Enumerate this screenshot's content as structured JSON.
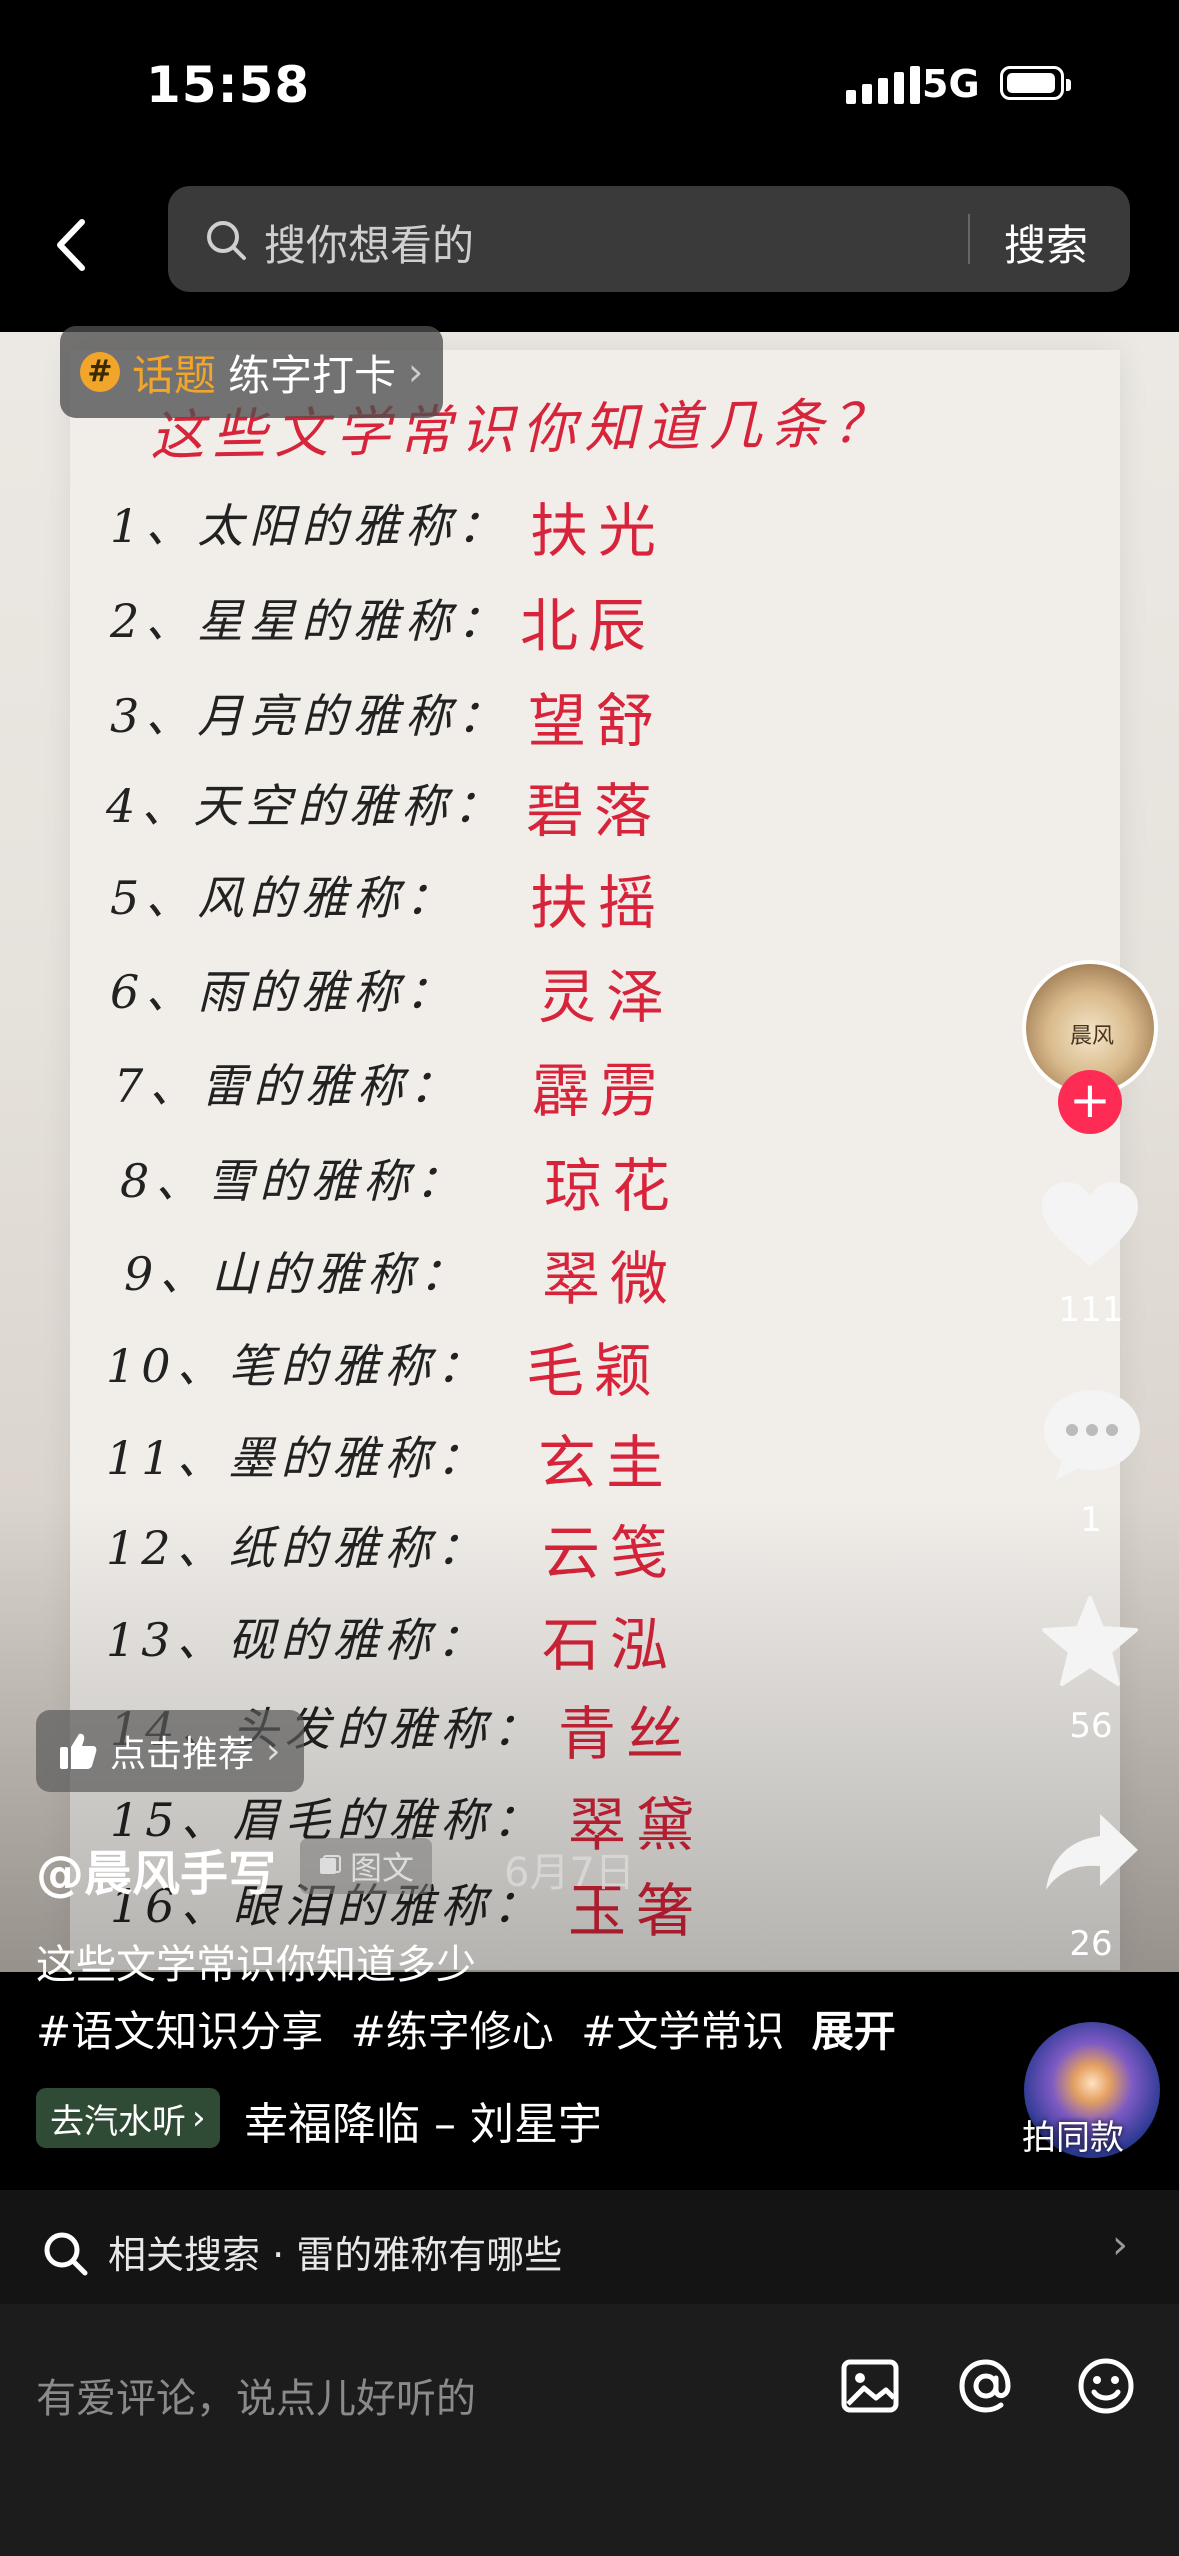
{
  "status_bar": {
    "time": "15:58",
    "network": "5G"
  },
  "search": {
    "placeholder": "搜你想看的",
    "button": "搜索"
  },
  "topic": {
    "kind": "话题",
    "name": "练字打卡",
    "icon_symbol": "#"
  },
  "note": {
    "title": "这些文学常识你知道几条？",
    "rows": [
      {
        "q": "1、太阳的雅称：",
        "a": "扶光"
      },
      {
        "q": "2、星星的雅称：",
        "a": "北辰"
      },
      {
        "q": "3、月亮的雅称：",
        "a": "望舒"
      },
      {
        "q": "4、天空的雅称：",
        "a": "碧落"
      },
      {
        "q": "5、风的雅称：",
        "a": "扶摇"
      },
      {
        "q": "6、雨的雅称：",
        "a": "灵泽"
      },
      {
        "q": "7、雷的雅称：",
        "a": "霹雳"
      },
      {
        "q": "8、雪的雅称：",
        "a": "琼花"
      },
      {
        "q": "9、山的雅称：",
        "a": "翠微"
      },
      {
        "q": "10、笔的雅称：",
        "a": "毛颖"
      },
      {
        "q": "11、墨的雅称：",
        "a": "玄圭"
      },
      {
        "q": "12、纸的雅称：",
        "a": "云笺"
      },
      {
        "q": "13、砚的雅称：",
        "a": "石泓"
      },
      {
        "q": "14、头发的雅称：",
        "a": "青丝"
      },
      {
        "q": "15、眉毛的雅称：",
        "a": "翠黛"
      },
      {
        "q": "16、眼泪的雅称：",
        "a": "玉箸"
      }
    ]
  },
  "avatar_text": "晨风",
  "actions": {
    "likes": "111",
    "comments": "1",
    "favorites": "56",
    "shares": "26"
  },
  "recommend": {
    "label": "点击推荐"
  },
  "post": {
    "author": "@晨风手写",
    "type": "图文",
    "date": "6月7日",
    "description": "这些文学常识你知道多少",
    "tags": [
      "#语文知识分享",
      "#练字修心",
      "#文学常识"
    ],
    "expand": "展开"
  },
  "music": {
    "chip": "去汽水听",
    "title": "幸福降临 – 刘星宇",
    "same_label": "拍同款"
  },
  "related": {
    "label": "相关搜索 · 雷的雅称有哪些"
  },
  "comment": {
    "placeholder": "有爱评论，说点儿好听的"
  },
  "colors": {
    "accent": "#fe2c55",
    "topic": "#f2a52b",
    "ink_red": "#d8243a"
  }
}
